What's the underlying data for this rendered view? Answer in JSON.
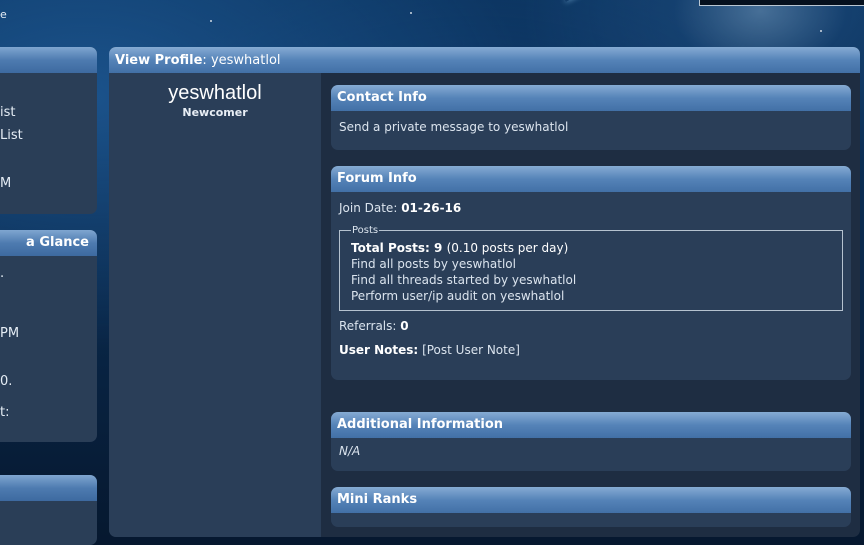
{
  "top_fragment": "e",
  "sidebar": {
    "block1": {
      "lines": [
        "ist",
        "List",
        "M"
      ]
    },
    "block2": {
      "title": "a Glance",
      "lines": [
        ".",
        "PM",
        "0.",
        "t:"
      ]
    }
  },
  "profile": {
    "header_label": "View Profile",
    "header_username": "yeswhatlol",
    "username": "yeswhatlol",
    "user_title": "Newcomer"
  },
  "contact": {
    "title": "Contact Info",
    "send_pm": "Send a private message to yeswhatlol"
  },
  "forum_info": {
    "title": "Forum Info",
    "join_label": "Join Date:",
    "join_value": "01-26-16",
    "posts_legend": "Posts",
    "total_posts_label": "Total Posts:",
    "total_posts_value": "9",
    "posts_per_day": "(0.10 posts per day)",
    "find_posts": "Find all posts by yeswhatlol",
    "find_threads": "Find all threads started by yeswhatlol",
    "audit": "Perform user/ip audit on yeswhatlol",
    "referrals_label": "Referrals:",
    "referrals_value": "0",
    "notes_label": "User Notes:",
    "notes_link": "[Post User Note]"
  },
  "additional": {
    "title": "Additional Information",
    "value": "N/A"
  },
  "mini_ranks": {
    "title": "Mini Ranks"
  }
}
